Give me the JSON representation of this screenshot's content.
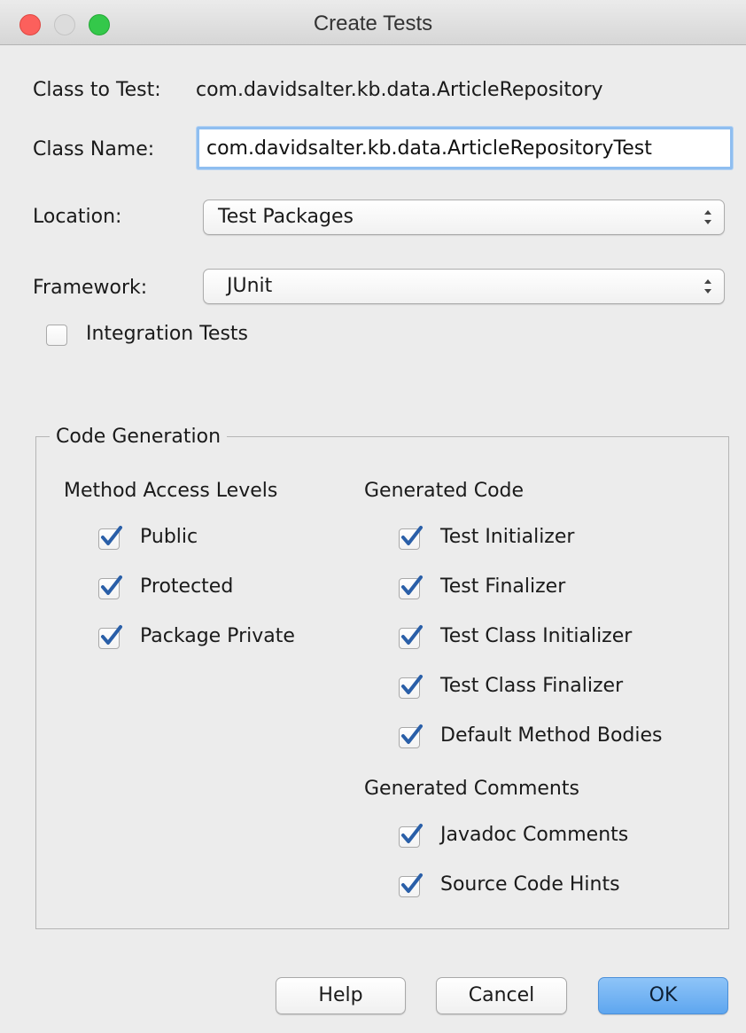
{
  "window": {
    "title": "Create Tests"
  },
  "form": {
    "class_to_test_label": "Class to Test:",
    "class_to_test_value": "com.davidsalter.kb.data.ArticleRepository",
    "class_name_label": "Class Name:",
    "class_name_value": "com.davidsalter.kb.data.ArticleRepositoryTest",
    "location_label": "Location:",
    "location_value": "Test Packages",
    "framework_label": "Framework:",
    "framework_value": "JUnit",
    "integration_tests_label": "Integration Tests",
    "integration_tests_checked": false
  },
  "code_generation": {
    "title": "Code Generation",
    "method_access": {
      "heading": "Method Access Levels",
      "items": [
        {
          "label": "Public",
          "checked": true
        },
        {
          "label": "Protected",
          "checked": true
        },
        {
          "label": "Package Private",
          "checked": true
        }
      ]
    },
    "generated_code": {
      "heading": "Generated Code",
      "items": [
        {
          "label": "Test Initializer",
          "checked": true
        },
        {
          "label": "Test Finalizer",
          "checked": true
        },
        {
          "label": "Test Class Initializer",
          "checked": true
        },
        {
          "label": "Test Class Finalizer",
          "checked": true
        },
        {
          "label": "Default Method Bodies",
          "checked": true
        }
      ]
    },
    "generated_comments": {
      "heading": "Generated Comments",
      "items": [
        {
          "label": "Javadoc Comments",
          "checked": true
        },
        {
          "label": "Source Code Hints",
          "checked": true
        }
      ]
    }
  },
  "buttons": {
    "help": "Help",
    "cancel": "Cancel",
    "ok": "OK"
  },
  "colors": {
    "checkmark": "#2a5fa8",
    "default_button": "#5ea6ef",
    "focus_ring": "#8fbef0"
  },
  "icons": {
    "close": "close-icon",
    "minimize": "minimize-icon",
    "maximize": "maximize-icon",
    "popup_arrows": "up-down-arrows-icon",
    "checkmark": "checkmark-icon"
  }
}
